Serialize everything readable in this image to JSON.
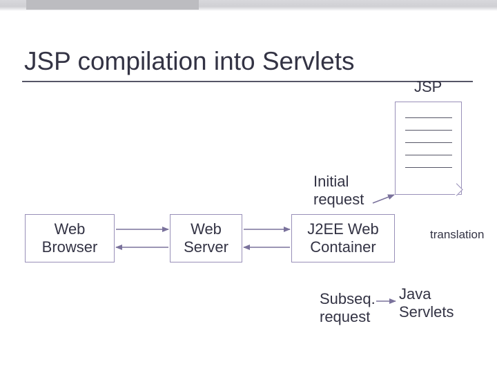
{
  "title": "JSP compilation into Servlets",
  "labels": {
    "jsp": "JSP",
    "initial_request_l1": "Initial",
    "initial_request_l2": "request",
    "translation": "translation",
    "subseq_l1": "Subseq.",
    "subseq_l2": "request",
    "java_servlets_l1": "Java",
    "java_servlets_l2": "Servlets"
  },
  "boxes": {
    "web_browser_l1": "Web",
    "web_browser_l2": "Browser",
    "web_server_l1": "Web",
    "web_server_l2": "Server",
    "j2ee_l1": "J2EE Web",
    "j2ee_l2": "Container"
  },
  "colors": {
    "box_border": "#988fb8",
    "arrow": "#7a729c",
    "text": "#333344"
  }
}
